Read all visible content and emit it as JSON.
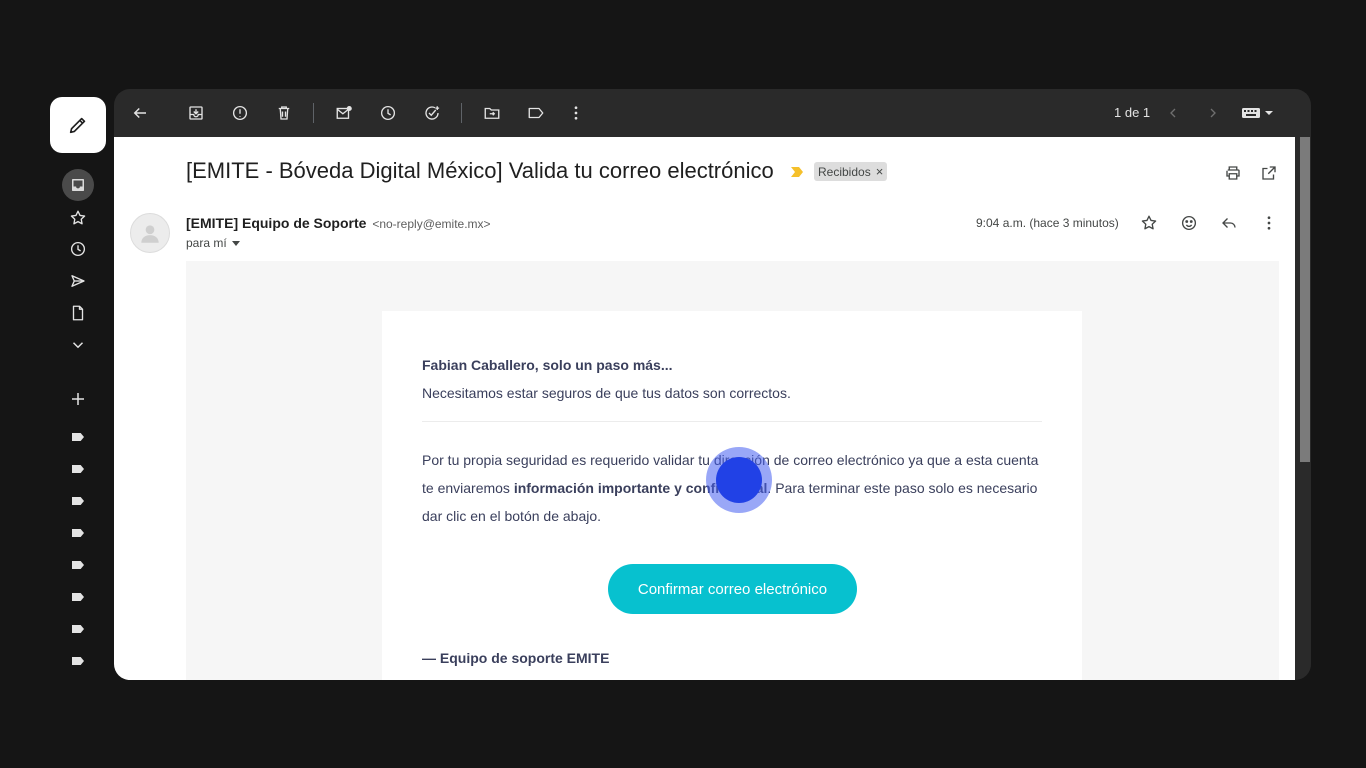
{
  "rail": {
    "compose_icon": "pencil-icon",
    "nav_icons": [
      "inbox-icon",
      "star-icon",
      "clock-icon",
      "send-icon",
      "file-icon",
      "chevron-down-icon"
    ],
    "add_label_icon": "plus-icon",
    "label_icons": [
      "label-icon",
      "label-icon",
      "label-icon",
      "label-icon",
      "label-icon",
      "label-icon",
      "label-icon",
      "label-icon"
    ]
  },
  "toolbar": {
    "pager_text": "1 de 1"
  },
  "email": {
    "subject": "[EMITE - Bóveda Digital México] Valida tu correo electrónico",
    "label": "Recibidos",
    "label_remove": "×",
    "sender_name": "[EMITE] Equipo de Soporte",
    "sender_address": "<no-reply@emite.mx>",
    "to": "para mí",
    "time": "9:04 a.m. (hace 3 minutos)"
  },
  "body": {
    "greeting": "Fabian Caballero, solo un paso más...",
    "subtext": "Necesitamos estar seguros de que tus datos son correctos.",
    "para_start": "Por tu propia seguridad es requerido validar tu dirección de correo electrónico ya que a esta cuenta te enviaremos ",
    "para_bold": "información importante y confidencial",
    "para_end": ". Para terminar este paso solo es necesario dar clic en el botón de abajo.",
    "button": "Confirmar correo electrónico",
    "signature": "— Equipo de soporte EMITE"
  },
  "colors": {
    "cta": "#07c1cf",
    "text": "#3a3f5c",
    "importance": "#f5c02b",
    "cursor": "#2141e6"
  }
}
